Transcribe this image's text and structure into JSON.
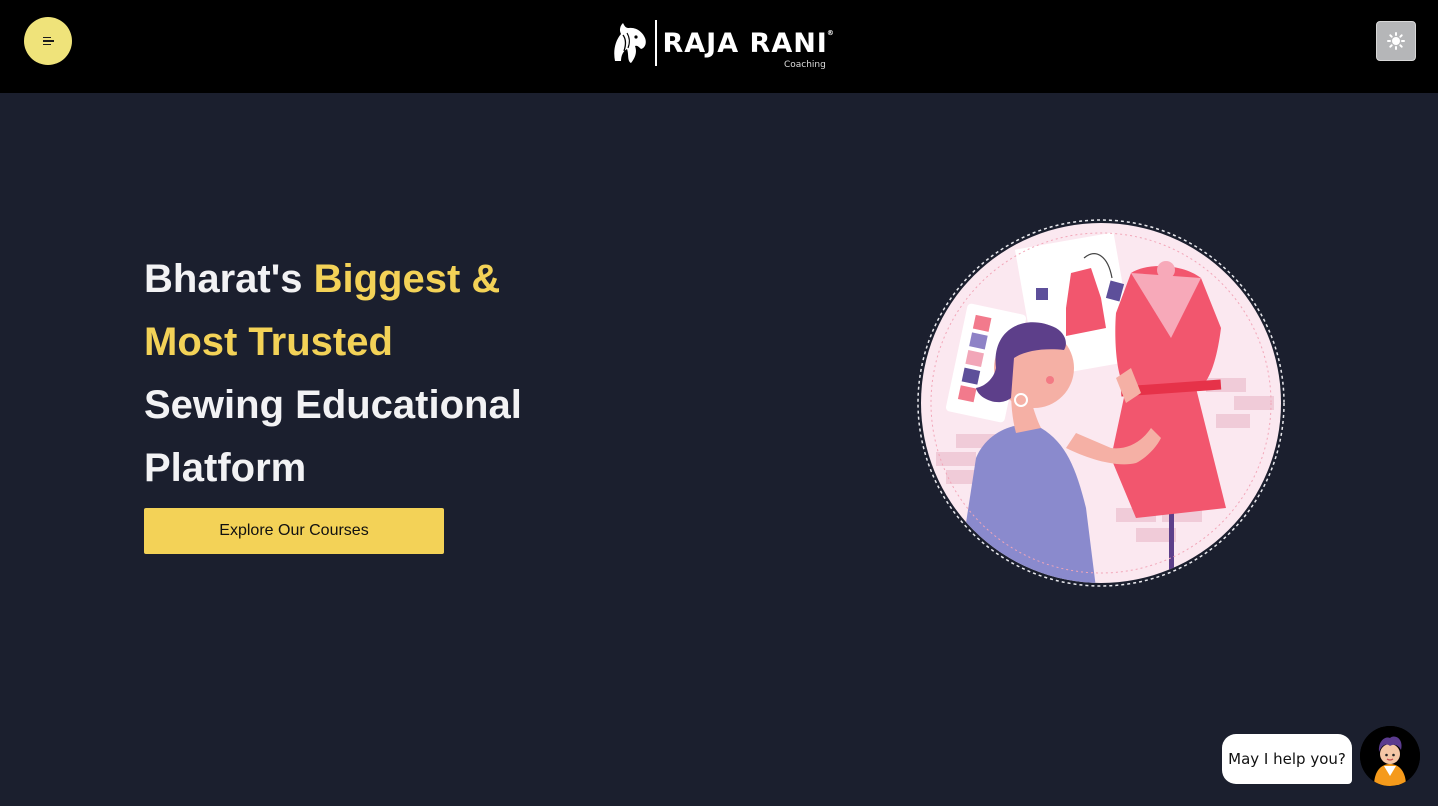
{
  "header": {
    "logo_text": "RAJA RANI",
    "logo_sub": "Coaching",
    "logo_reg": "®"
  },
  "hero": {
    "title_part1": "Bharat's ",
    "title_accent": "Biggest & Most Trusted",
    "title_part2": "Sewing Educational Platform",
    "cta_label": "Explore Our Courses"
  },
  "chat": {
    "prompt": "May I help you?"
  },
  "colors": {
    "background": "#1b1f2e",
    "header": "#000000",
    "accent": "#f3d257",
    "menu_button": "#efe37a"
  },
  "icons": [
    "menu-icon",
    "horse-logo-icon",
    "sun-icon",
    "chat-assistant-avatar"
  ]
}
